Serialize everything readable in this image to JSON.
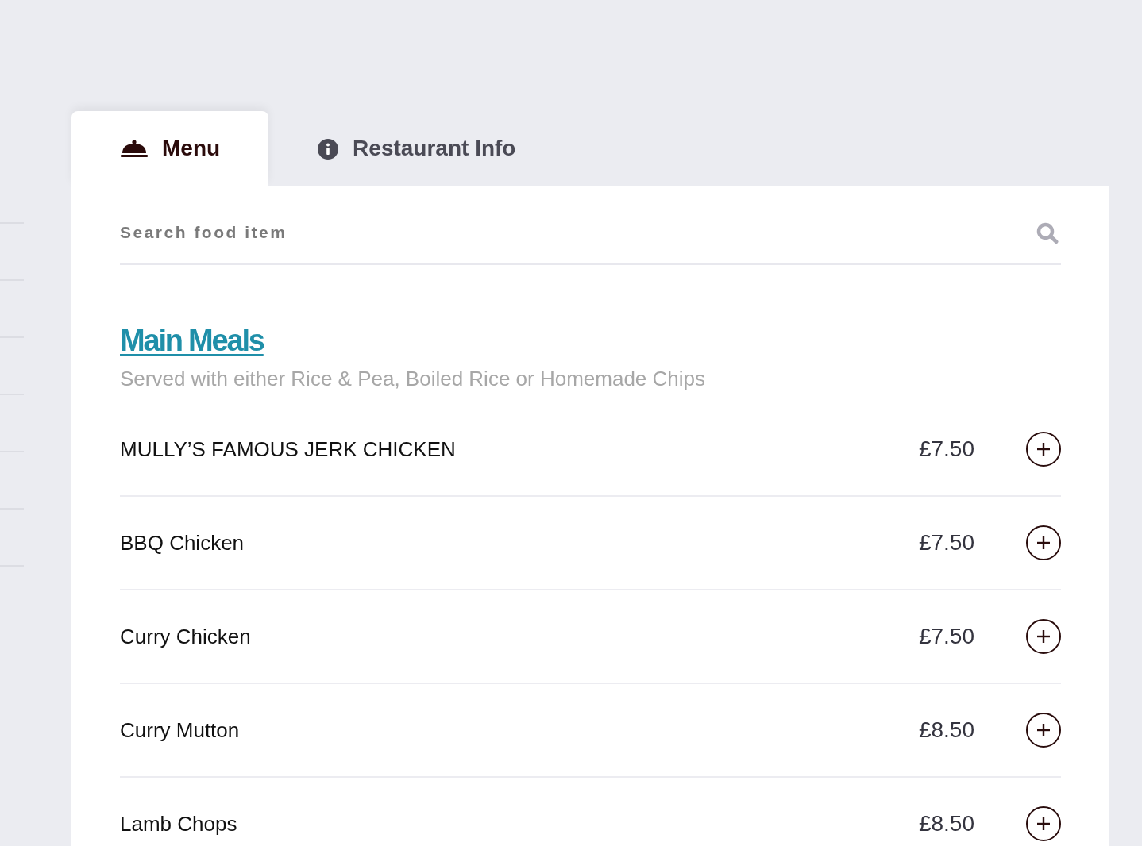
{
  "tabs": [
    {
      "label": "Menu",
      "selected": true
    },
    {
      "label": "Restaurant Info",
      "selected": false
    }
  ],
  "search": {
    "placeholder": "Search food item"
  },
  "section": {
    "title": "Main Meals",
    "subtitle": "Served with either Rice & Pea, Boiled Rice or Homemade Chips"
  },
  "items": [
    {
      "name": "MULLY’S FAMOUS JERK CHICKEN",
      "price": "£7.50"
    },
    {
      "name": "BBQ Chicken",
      "price": "£7.50"
    },
    {
      "name": "Curry Chicken",
      "price": "£7.50"
    },
    {
      "name": "Curry Mutton",
      "price": "£8.50"
    },
    {
      "name": "Lamb Chops",
      "price": "£8.50"
    }
  ]
}
